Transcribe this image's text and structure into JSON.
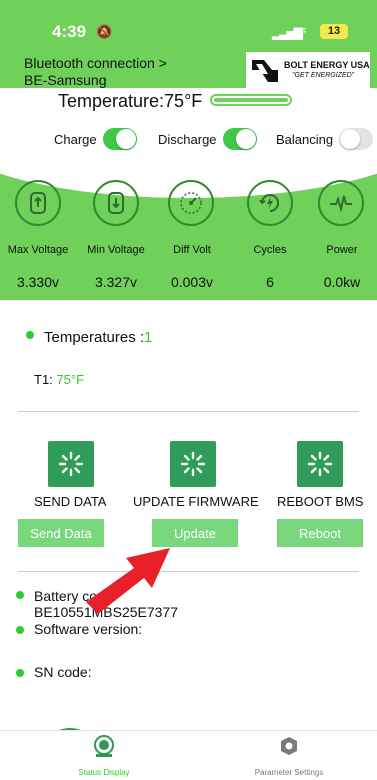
{
  "status_bar": {
    "time": "4:39",
    "battery": "13"
  },
  "header": {
    "bluetooth_line1": "Bluetooth connection >",
    "bluetooth_line2": "BE-Samsung",
    "logo_brand": "BOLT ENERGY USA",
    "logo_tagline": "\"GET ENERGIZED\""
  },
  "temperature": {
    "label": "Temperature:75°F"
  },
  "toggles": [
    {
      "label": "Charge",
      "state": "on"
    },
    {
      "label": "Discharge",
      "state": "on"
    },
    {
      "label": "Balancing",
      "state": "off"
    }
  ],
  "stats": [
    {
      "label": "Max Voltage",
      "value": "3.330v",
      "icon": "battery-up-icon"
    },
    {
      "label": "Min Voltage",
      "value": "3.327v",
      "icon": "battery-down-icon"
    },
    {
      "label": "Diff Volt",
      "value": "0.003v",
      "icon": "gauge-icon"
    },
    {
      "label": "Cycles",
      "value": "6",
      "icon": "cycle-bolt-icon"
    },
    {
      "label": "Power",
      "value": "0.0kw",
      "icon": "pulse-icon"
    }
  ],
  "temperatures": {
    "title": "Temperatures :",
    "count": "1",
    "t1_label": "T1:",
    "t1_value": "75°F"
  },
  "actions": [
    {
      "title": "SEND DATA",
      "button": "Send Data"
    },
    {
      "title": "UPDATE FIRMWARE",
      "button": "Update"
    },
    {
      "title": "REBOOT BMS",
      "button": "Reboot"
    }
  ],
  "info": {
    "battery_code_label": "Battery code:",
    "battery_code_value": "BE10551MBS25E7377",
    "software_version_label": "Software version:",
    "sn_code_label": "SN code:"
  },
  "tabs": [
    {
      "label": "Status Display",
      "active": true
    },
    {
      "label": "Parameter Settings",
      "active": false
    }
  ],
  "colors": {
    "header_green": "#6fd15a",
    "accent_green": "#2ecc2e",
    "button_green": "#79d87e",
    "icon_box_green": "#2f9c57",
    "arrow_red": "#e8202a"
  }
}
